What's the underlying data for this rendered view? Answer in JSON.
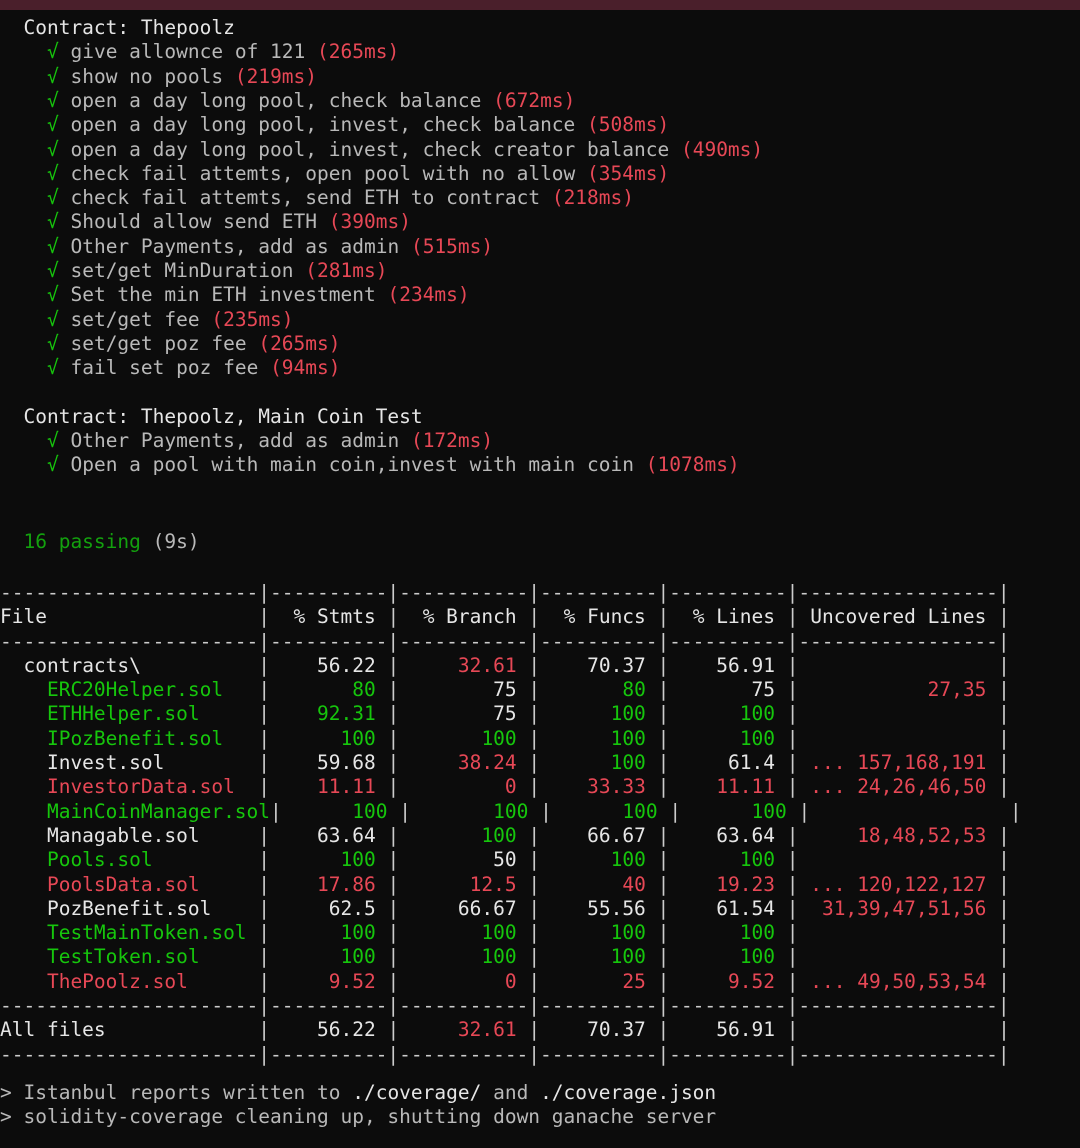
{
  "suites": [
    {
      "name": "Contract: Thepoolz",
      "tests": [
        {
          "title": "give allownce of 121",
          "time": "(265ms)"
        },
        {
          "title": "show no pools",
          "time": "(219ms)"
        },
        {
          "title": "open a day long pool, check balance",
          "time": "(672ms)"
        },
        {
          "title": "open a day long pool, invest, check balance",
          "time": "(508ms)"
        },
        {
          "title": "open a day long pool, invest, check creator balance",
          "time": "(490ms)"
        },
        {
          "title": "check fail attemts, open pool with no allow",
          "time": "(354ms)"
        },
        {
          "title": "check fail attemts, send ETH to contract",
          "time": "(218ms)"
        },
        {
          "title": "Should allow send ETH",
          "time": "(390ms)"
        },
        {
          "title": "Other Payments, add as admin",
          "time": "(515ms)"
        },
        {
          "title": "set/get MinDuration",
          "time": "(281ms)"
        },
        {
          "title": "Set the min ETH investment",
          "time": "(234ms)"
        },
        {
          "title": "set/get fee",
          "time": "(235ms)"
        },
        {
          "title": "set/get poz fee",
          "time": "(265ms)"
        },
        {
          "title": "fail set poz fee",
          "time": "(94ms)"
        }
      ]
    },
    {
      "name": "Contract: Thepoolz, Main Coin Test",
      "tests": [
        {
          "title": "Other Payments, add as admin",
          "time": "(172ms)"
        },
        {
          "title": "Open a pool with main coin,invest with main coin",
          "time": "(1078ms)"
        }
      ]
    }
  ],
  "check_glyph": "√",
  "passing": {
    "count": "16 passing",
    "duration": "(9s)"
  },
  "coverage": {
    "headers": [
      "File",
      "% Stmts",
      "% Branch",
      "% Funcs",
      "% Lines",
      "Uncovered Lines"
    ],
    "rows": [
      {
        "file": " contracts\\",
        "stmts": "56.22",
        "branch": "32.61",
        "funcs": "70.37",
        "lines": "56.91",
        "uncovered": ""
      },
      {
        "file": "  ERC20Helper.sol",
        "stmts": "80",
        "branch": "75",
        "funcs": "80",
        "lines": "75",
        "uncovered": "27,35"
      },
      {
        "file": "  ETHHelper.sol",
        "stmts": "92.31",
        "branch": "75",
        "funcs": "100",
        "lines": "100",
        "uncovered": ""
      },
      {
        "file": "  IPozBenefit.sol",
        "stmts": "100",
        "branch": "100",
        "funcs": "100",
        "lines": "100",
        "uncovered": ""
      },
      {
        "file": "  Invest.sol",
        "stmts": "59.68",
        "branch": "38.24",
        "funcs": "100",
        "lines": "61.4",
        "uncovered": "... 157,168,191"
      },
      {
        "file": "  InvestorData.sol",
        "stmts": "11.11",
        "branch": "0",
        "funcs": "33.33",
        "lines": "11.11",
        "uncovered": "... 24,26,46,50"
      },
      {
        "file": "  MainCoinManager.sol",
        "stmts": "100",
        "branch": "100",
        "funcs": "100",
        "lines": "100",
        "uncovered": ""
      },
      {
        "file": "  Managable.sol",
        "stmts": "63.64",
        "branch": "100",
        "funcs": "66.67",
        "lines": "63.64",
        "uncovered": "18,48,52,53"
      },
      {
        "file": "  Pools.sol",
        "stmts": "100",
        "branch": "50",
        "funcs": "100",
        "lines": "100",
        "uncovered": ""
      },
      {
        "file": "  PoolsData.sol",
        "stmts": "17.86",
        "branch": "12.5",
        "funcs": "40",
        "lines": "19.23",
        "uncovered": "... 120,122,127"
      },
      {
        "file": "  PozBenefit.sol",
        "stmts": "62.5",
        "branch": "66.67",
        "funcs": "55.56",
        "lines": "61.54",
        "uncovered": "31,39,47,51,56"
      },
      {
        "file": "  TestMainToken.sol",
        "stmts": "100",
        "branch": "100",
        "funcs": "100",
        "lines": "100",
        "uncovered": ""
      },
      {
        "file": "  TestToken.sol",
        "stmts": "100",
        "branch": "100",
        "funcs": "100",
        "lines": "100",
        "uncovered": ""
      },
      {
        "file": "  ThePoolz.sol",
        "stmts": "9.52",
        "branch": "0",
        "funcs": "25",
        "lines": "9.52",
        "uncovered": "... 49,50,53,54"
      }
    ],
    "total": {
      "file": "All files",
      "stmts": "56.22",
      "branch": "32.61",
      "funcs": "70.37",
      "lines": "56.91",
      "uncovered": ""
    }
  },
  "footer": [
    {
      "prompt": ">",
      "parts": [
        {
          "text": " Istanbul reports written to ",
          "tone": "gray"
        },
        {
          "text": "./coverage/",
          "tone": "white"
        },
        {
          "text": " and ",
          "tone": "gray"
        },
        {
          "text": "./coverage.json",
          "tone": "white"
        }
      ]
    },
    {
      "prompt": ">",
      "parts": [
        {
          "text": " solidity-coverage cleaning up, shutting down ganache server",
          "tone": "gray"
        }
      ]
    }
  ],
  "colors": {
    "background": "#0c0c0c",
    "titlebar": "#4a1f2b",
    "pass_green": "#16c60c",
    "time_red": "#e74856",
    "text": "#cccccc"
  }
}
